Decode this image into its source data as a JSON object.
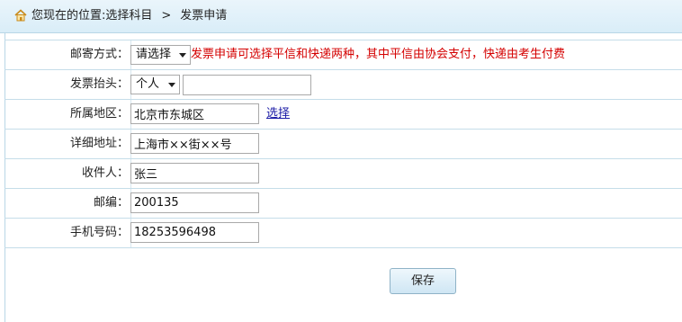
{
  "breadcrumb": {
    "prefix": "您现在的位置:选择科目",
    "separator": ">",
    "current": "发票申请"
  },
  "form": {
    "mail_method": {
      "label": "邮寄方式：",
      "selected": "请选择",
      "hint": "发票申请可选择平信和快递两种，其中平信由协会支付，快递由考生付费"
    },
    "invoice_title": {
      "label": "发票抬头：",
      "selected": "个人",
      "value": ""
    },
    "region": {
      "label": "所属地区：",
      "value": "北京市东城区",
      "link": "选择"
    },
    "address": {
      "label": "详细地址：",
      "value": "上海市××街××号"
    },
    "recipient": {
      "label": "收件人：",
      "value": "张三"
    },
    "postcode": {
      "label": "邮编：",
      "value": "200135"
    },
    "phone": {
      "label": "手机号码：",
      "value": "18253596498"
    }
  },
  "actions": {
    "save_label": "保存"
  },
  "icons": {
    "home": "home-icon"
  }
}
